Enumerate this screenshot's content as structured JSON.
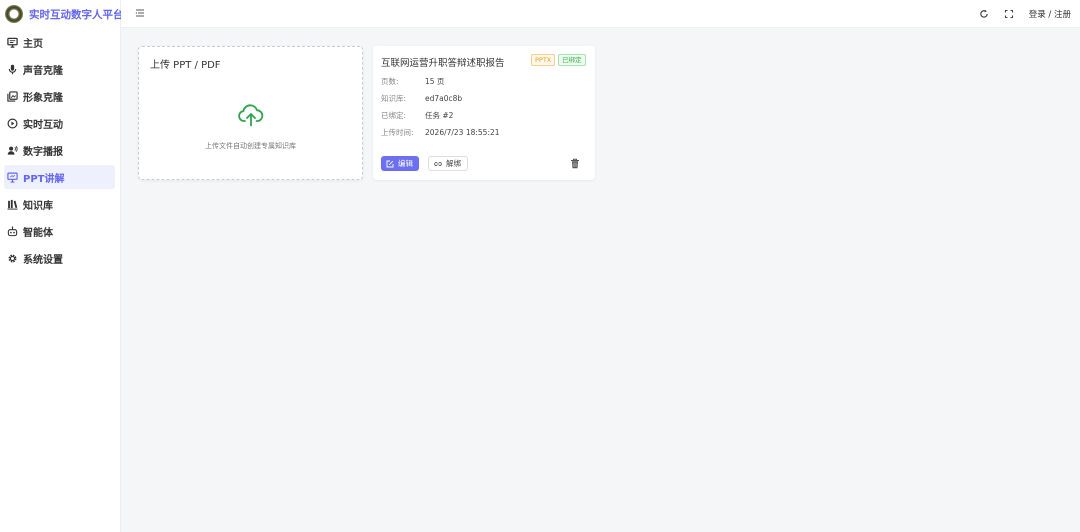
{
  "app": {
    "title": "实时互动数字人平台"
  },
  "sidebar": {
    "items": [
      {
        "label": "主页",
        "icon": "monitor-icon"
      },
      {
        "label": "声音克隆",
        "icon": "microphone-icon"
      },
      {
        "label": "形象克隆",
        "icon": "image-stack-icon"
      },
      {
        "label": "实时互动",
        "icon": "play-circle-icon"
      },
      {
        "label": "数字播报",
        "icon": "user-broadcast-icon"
      },
      {
        "label": "PPT讲解",
        "icon": "presentation-icon"
      },
      {
        "label": "知识库",
        "icon": "library-icon"
      },
      {
        "label": "智能体",
        "icon": "robot-icon"
      },
      {
        "label": "系统设置",
        "icon": "gear-icon"
      }
    ],
    "active_index": 5
  },
  "header": {
    "login_label": "登录 / 注册"
  },
  "upload": {
    "title": "上传 PPT / PDF",
    "hint": "上传文件自动创建专属知识库"
  },
  "card": {
    "title": "互联网运营升职答辩述职报告",
    "type_badge": "PPTX",
    "status_badge": "已绑定",
    "fields": [
      {
        "key": "页数:",
        "value": "15 页"
      },
      {
        "key": "知识库:",
        "value": "ed7a0c8b"
      },
      {
        "key": "已绑定:",
        "value": "任务 #2"
      },
      {
        "key": "上传时间:",
        "value": "2026/7/23 18:55:21"
      }
    ],
    "edit_label": "编辑",
    "unbind_label": "解绑"
  },
  "colors": {
    "accent": "#6366f1",
    "upload_icon": "#2ea44f",
    "badge_type": "#f0a020",
    "badge_bound": "#3bb346"
  }
}
